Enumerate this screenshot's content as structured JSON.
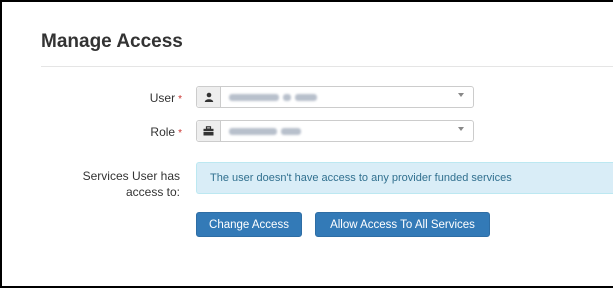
{
  "page": {
    "title": "Manage Access"
  },
  "form": {
    "user": {
      "label": "User",
      "required_mark": "*",
      "icon": "user-icon"
    },
    "role": {
      "label": "Role",
      "required_mark": "*",
      "icon": "briefcase-icon"
    },
    "services": {
      "label_line1": "Services User has",
      "label_line2": "access to:",
      "message": "The user doesn't have access to any provider funded services"
    }
  },
  "actions": {
    "change_access": "Change Access",
    "allow_all": "Allow Access To All Services"
  },
  "colors": {
    "primary": "#337ab7",
    "info_bg": "#d9edf7",
    "info_text": "#31708f",
    "required": "#c9302c"
  }
}
